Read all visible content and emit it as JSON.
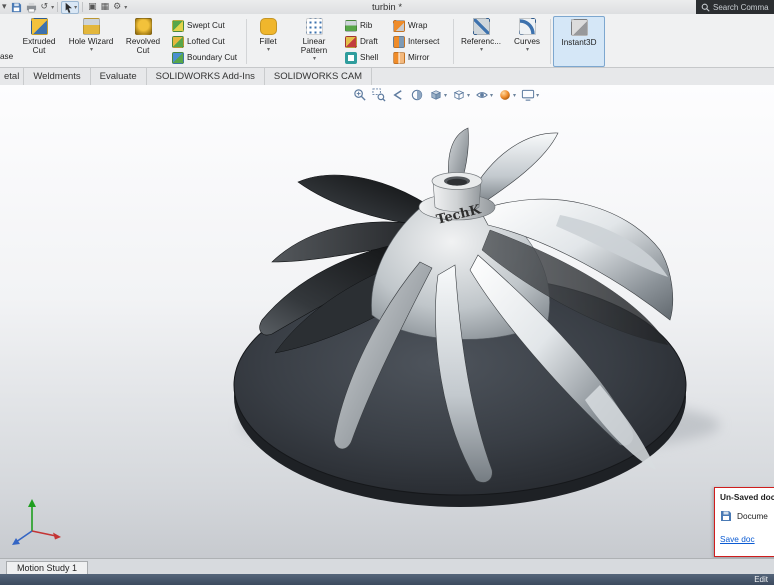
{
  "titlebar": {
    "title": "turbin *",
    "search_label": "Search Comma"
  },
  "ribbon": {
    "partial_button_label": "ase",
    "buttons": [
      {
        "label": "Extruded Cut"
      },
      {
        "label": "Hole Wizard"
      },
      {
        "label": "Revolved Cut"
      },
      {
        "label": "Swept Cut"
      },
      {
        "label": "Lofted Cut"
      },
      {
        "label": "Boundary Cut"
      },
      {
        "label": "Fillet"
      },
      {
        "label": "Linear Pattern"
      },
      {
        "label": "Rib"
      },
      {
        "label": "Draft"
      },
      {
        "label": "Shell"
      },
      {
        "label": "Wrap"
      },
      {
        "label": "Intersect"
      },
      {
        "label": "Mirror"
      },
      {
        "label": "Referenc..."
      },
      {
        "label": "Curves"
      },
      {
        "label": "Instant3D"
      }
    ]
  },
  "tabs": {
    "items": [
      {
        "label": "etal"
      },
      {
        "label": "Weldments"
      },
      {
        "label": "Evaluate"
      },
      {
        "label": "SOLIDWORKS Add-Ins"
      },
      {
        "label": "SOLIDWORKS CAM"
      }
    ]
  },
  "viewport": {
    "model_text": "TechK"
  },
  "unsaved_popup": {
    "title": "Un-Saved docu",
    "message": "Docume",
    "link": "Save doc"
  },
  "motion_bar": {
    "tab_label": "Motion Study 1"
  },
  "status_bar": {
    "right_text": "Edit"
  },
  "colors": {
    "accent_blue": "#3d72ae",
    "popup_border_red": "#cf1d1d",
    "link_blue": "#0b5bd3"
  }
}
